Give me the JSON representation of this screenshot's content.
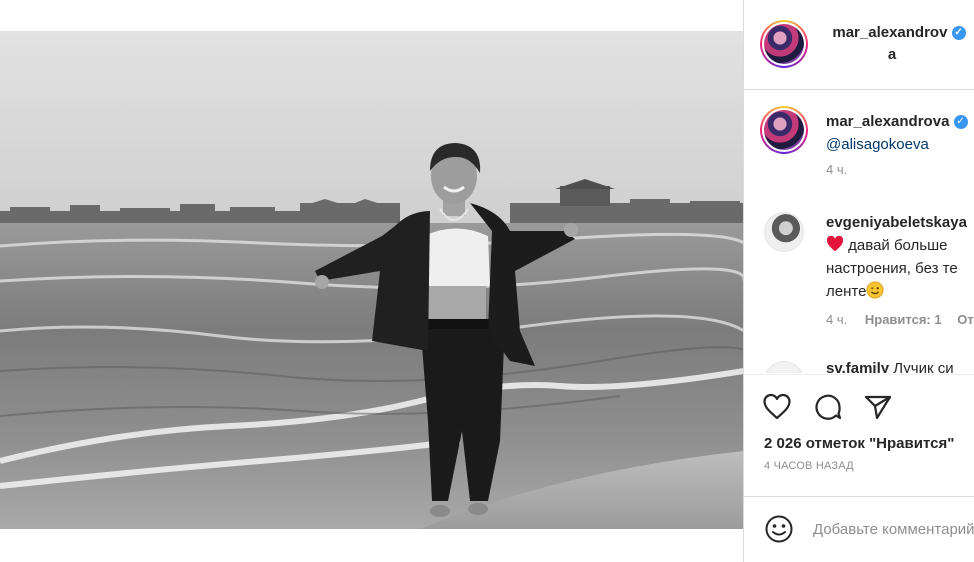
{
  "post": {
    "photo_alt_icon": "photo-image",
    "author": {
      "username_line1": "mar_alexandrov",
      "username_line2": "a",
      "verified_icon": "verified-badge-icon"
    }
  },
  "comments": [
    {
      "username": "mar_alexandrova",
      "text_mention": "@alisagokoeva",
      "time": "4 ч."
    },
    {
      "username": "evgeniyabeletskaya",
      "line1": "давай больше",
      "line1_icon": "heart-emoji",
      "line2": "настроения, без те",
      "line3": "ленте",
      "line3_icon": "wink-emoji",
      "time": "4 ч.",
      "likes_label": "Нравится: 1",
      "reply_label": "От"
    },
    {
      "username": "sv.family",
      "text": "Лучик си"
    }
  ],
  "actions": {
    "like_icon": "heart-outline-icon",
    "comment_icon": "comment-bubble-icon",
    "share_icon": "send-paper-plane-icon",
    "likes_text": "2 026 отметок \"Нравится\"",
    "time_ago": "4 ЧАСОВ НАЗАД"
  },
  "add_comment": {
    "emoji_icon": "smiley-face-icon",
    "placeholder": "Добавьте комментарий..."
  },
  "colors": {
    "verified": "#3897f0",
    "mention": "#00376b",
    "meta": "#8e8e8e",
    "heart": "#ed4956"
  }
}
